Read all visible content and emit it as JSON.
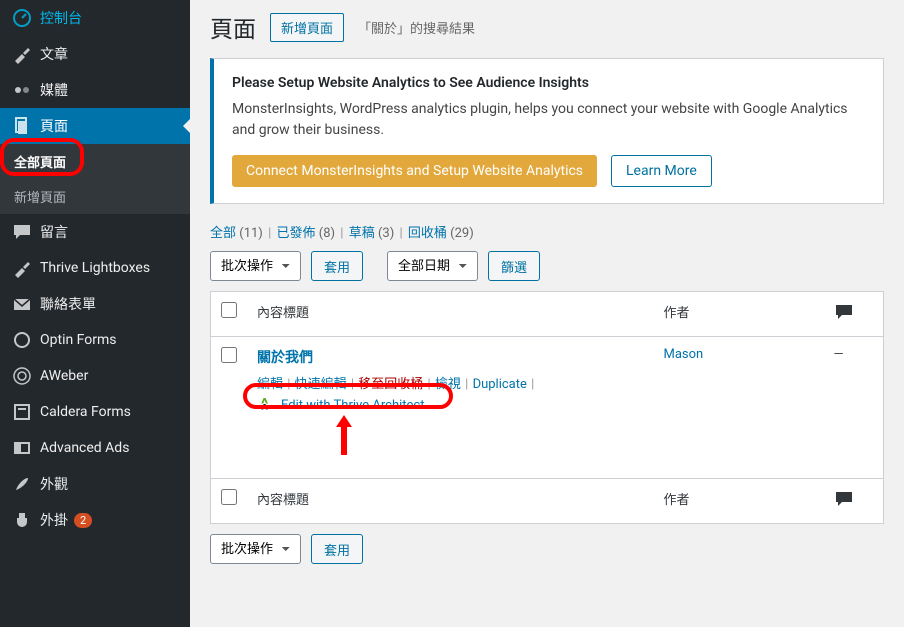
{
  "sidebar": {
    "items": [
      {
        "label": "控制台"
      },
      {
        "label": "文章"
      },
      {
        "label": "媒體"
      },
      {
        "label": "頁面"
      },
      {
        "label": "留言"
      },
      {
        "label": "Thrive Lightboxes"
      },
      {
        "label": "聯絡表單"
      },
      {
        "label": "Optin Forms"
      },
      {
        "label": "AWeber"
      },
      {
        "label": "Caldera Forms"
      },
      {
        "label": "Advanced Ads"
      },
      {
        "label": "外觀"
      },
      {
        "label": "外掛"
      }
    ],
    "sub": {
      "all_pages": "全部頁面",
      "add_new": "新增頁面"
    },
    "plugin_badge": "2"
  },
  "header": {
    "title": "頁面",
    "add_new": "新增頁面",
    "search_result": "「關於」的搜尋結果"
  },
  "notice": {
    "title": "Please Setup Website Analytics to See Audience Insights",
    "body": "MonsterInsights, WordPress analytics plugin, helps you connect your website with Google Analytics and grow their business.",
    "cta": "Connect MonsterInsights and Setup Website Analytics",
    "learn": "Learn More"
  },
  "filters": {
    "all": "全部",
    "all_n": "(11)",
    "published": "已發佈",
    "published_n": "(8)",
    "draft": "草稿",
    "draft_n": "(3)",
    "trash": "回收桶",
    "trash_n": "(29)"
  },
  "bulk": {
    "label": "批次操作",
    "apply": "套用"
  },
  "date": {
    "label": "全部日期",
    "filter": "篩選"
  },
  "columns": {
    "title": "內容標題",
    "author": "作者"
  },
  "row": {
    "title": "關於我們",
    "author": "Mason",
    "comments": "—",
    "actions": {
      "edit": "編輯",
      "quick": "快速編輯",
      "trash": "移至回收桶",
      "view": "檢視",
      "dup": "Duplicate",
      "thrive": "Edit with Thrive Architect"
    }
  }
}
